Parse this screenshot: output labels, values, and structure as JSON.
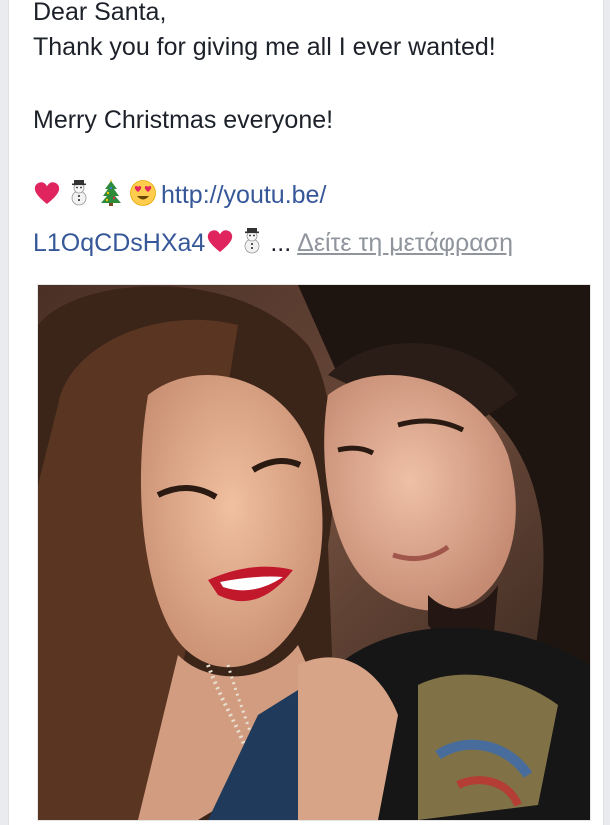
{
  "post": {
    "greeting": "Dear Santa,",
    "line2": "Thank you for giving me all I ever wanted!",
    "line3": "Merry Christmas everyone!",
    "link_part1": "http://youtu.be/",
    "link_part2": "L1OqCDsHXa4",
    "ellipsis": "...",
    "see_translation": "Δείτε τη μετάφραση",
    "emojis_line4": [
      "heart-emoji",
      "snowman-emoji",
      "christmas-tree-emoji",
      "heart-eyes-emoji"
    ],
    "emojis_line5": [
      "heart-emoji",
      "snowman-emoji"
    ]
  },
  "photo": {
    "description_icon": "photo-of-couple"
  },
  "colors": {
    "link": "#365899",
    "text": "#1d2129",
    "muted": "#90949c",
    "heart": "#e0245e"
  }
}
